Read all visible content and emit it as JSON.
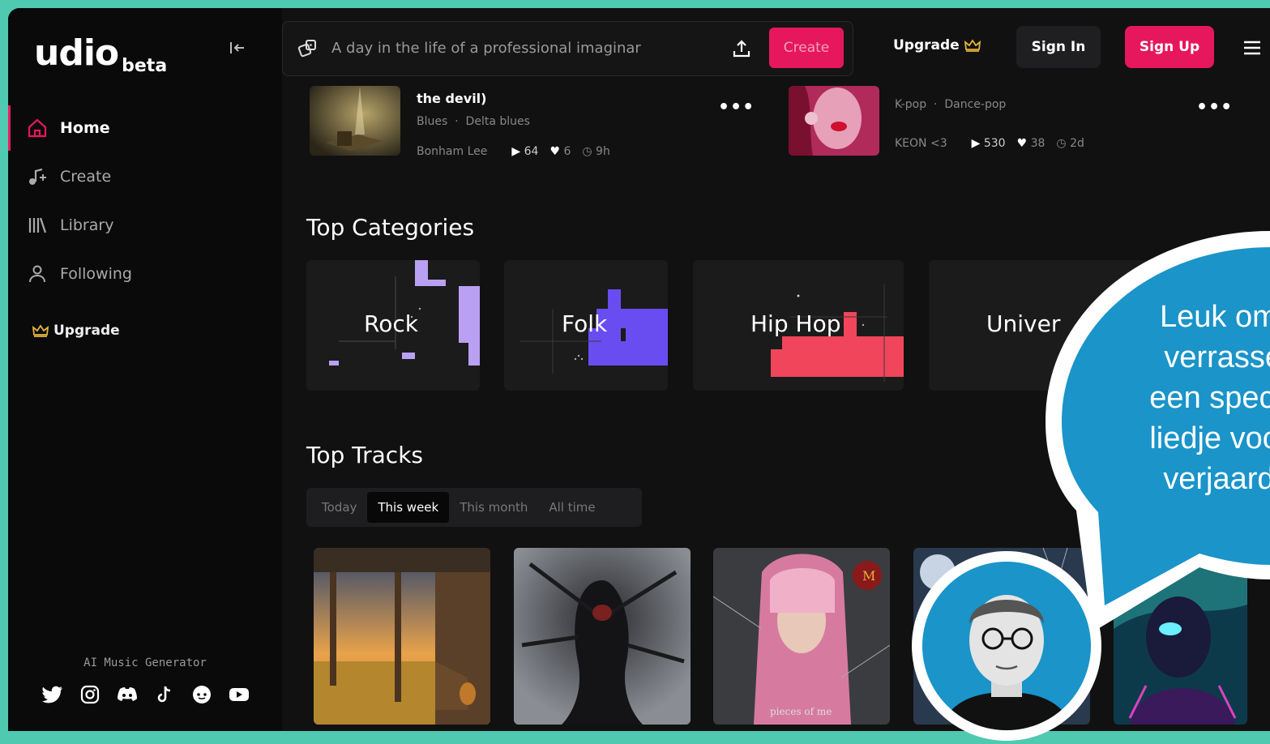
{
  "app": {
    "logo": "udio",
    "logo_suffix": "beta"
  },
  "sidebar": {
    "items": [
      {
        "label": "Home",
        "icon": "home-icon"
      },
      {
        "label": "Create",
        "icon": "music-plus-icon"
      },
      {
        "label": "Library",
        "icon": "library-icon"
      },
      {
        "label": "Following",
        "icon": "person-icon"
      }
    ],
    "upgrade_label": "Upgrade",
    "footer_label": "AI Music Generator",
    "socials": [
      "twitter-icon",
      "instagram-icon",
      "discord-icon",
      "tiktok-icon",
      "reddit-icon",
      "youtube-icon"
    ]
  },
  "header": {
    "prompt_placeholder": "A day in the life of a professional imaginar",
    "create_label": "Create",
    "upgrade_label": "Upgrade",
    "sign_in_label": "Sign In",
    "sign_up_label": "Sign Up"
  },
  "top_strip": [
    {
      "title": "the devil)",
      "genres": [
        "Blues",
        "Delta blues"
      ],
      "artist": "Bonham Lee",
      "plays": "64",
      "likes": "6",
      "age": "9h"
    },
    {
      "title": "",
      "genres": [
        "K-pop",
        "Dance-pop"
      ],
      "artist": "KEON <3",
      "plays": "530",
      "likes": "38",
      "age": "2d"
    }
  ],
  "categories": {
    "title": "Top Categories",
    "items": [
      "Rock",
      "Folk",
      "Hip Hop",
      "Univer"
    ]
  },
  "tracks": {
    "title": "Top Tracks",
    "tabs": [
      "Today",
      "This week",
      "This month",
      "All time"
    ],
    "active_tab": "This week",
    "covers": [
      "porch-sunset-guitar",
      "dark-figure-tendrils",
      "pink-hair-girl",
      "moon-night",
      "neon-figure"
    ],
    "cover_caption": "pieces of me"
  },
  "bubble": {
    "text": "Leuk om te verrassen: een speciaal liedje voor je verjaardag"
  },
  "colors": {
    "accent": "#e6175c",
    "bubble": "#1a94c9",
    "frame": "#4fc9b0",
    "gold": "#e2b33c"
  }
}
